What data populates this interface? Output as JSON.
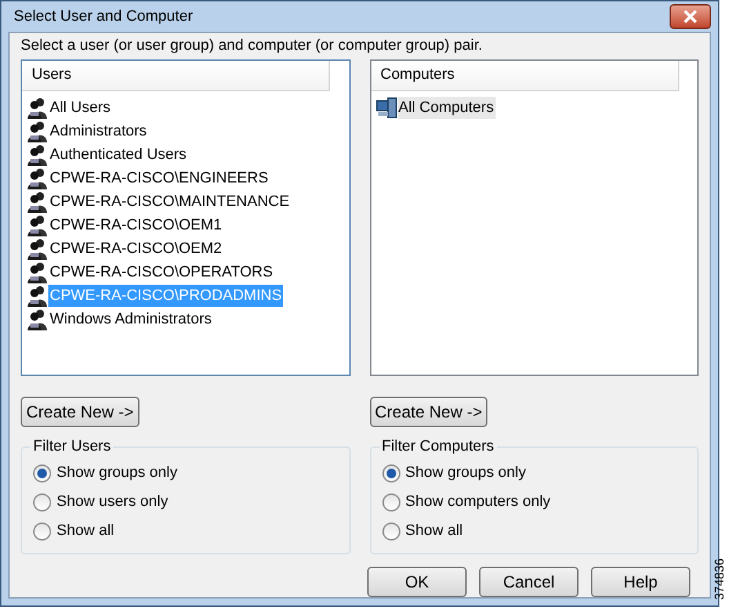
{
  "window": {
    "title": "Select User and Computer"
  },
  "instruction": "Select a user (or user group) and computer (or computer group) pair.",
  "lists": [
    {
      "header": "Users",
      "focused": true,
      "items": [
        {
          "label": "All Users",
          "kind": "group",
          "selected": false
        },
        {
          "label": "Administrators",
          "kind": "group",
          "selected": false
        },
        {
          "label": "Authenticated Users",
          "kind": "group",
          "selected": false
        },
        {
          "label": "CPWE-RA-CISCO\\ENGINEERS",
          "kind": "group",
          "selected": false
        },
        {
          "label": "CPWE-RA-CISCO\\MAINTENANCE",
          "kind": "group",
          "selected": false
        },
        {
          "label": "CPWE-RA-CISCO\\OEM1",
          "kind": "group",
          "selected": false
        },
        {
          "label": "CPWE-RA-CISCO\\OEM2",
          "kind": "group",
          "selected": false
        },
        {
          "label": "CPWE-RA-CISCO\\OPERATORS",
          "kind": "group",
          "selected": false
        },
        {
          "label": "CPWE-RA-CISCO\\PRODADMINS",
          "kind": "group",
          "selected": true
        },
        {
          "label": "Windows Administrators",
          "kind": "group",
          "selected": false
        }
      ],
      "create_button": "Create New ->",
      "filter": {
        "title": "Filter Users",
        "options": [
          {
            "label": "Show groups only",
            "selected": true
          },
          {
            "label": "Show users only",
            "selected": false
          },
          {
            "label": "Show all",
            "selected": false
          }
        ]
      }
    },
    {
      "header": "Computers",
      "focused": false,
      "items": [
        {
          "label": "All Computers",
          "kind": "computer",
          "selected": true
        }
      ],
      "create_button": "Create New ->",
      "filter": {
        "title": "Filter Computers",
        "options": [
          {
            "label": "Show groups only",
            "selected": true
          },
          {
            "label": "Show computers only",
            "selected": false
          },
          {
            "label": "Show all",
            "selected": false
          }
        ]
      }
    }
  ],
  "buttons": [
    "OK",
    "Cancel",
    "Help"
  ],
  "figure_number": "374836"
}
